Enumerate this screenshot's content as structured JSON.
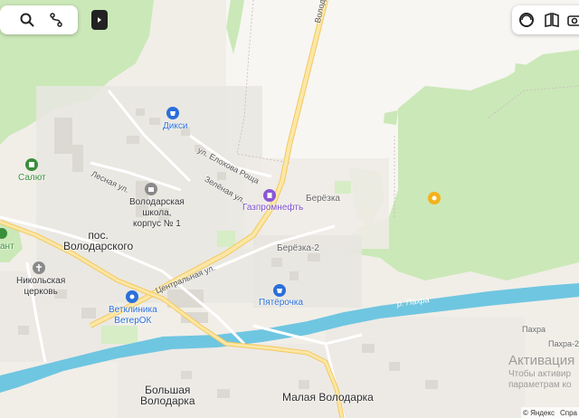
{
  "toolbar_left": {
    "search_icon": "search-icon",
    "route_icon": "route-icon",
    "collapse_icon": "play-arrow-icon"
  },
  "toolbar_right": {
    "icons": [
      "layers-icon",
      "map-book-icon",
      "camera-icon"
    ]
  },
  "settlements": {
    "volodarsky_line1": "пос.",
    "volodarsky_line2": "Володарского",
    "bolshaya_line1": "Большая",
    "bolshaya_line2": "Володарка",
    "malaya": "Малая Володарка",
    "berezka": "Берёзка",
    "berezka2": "Берёзка-2",
    "pakhra": "Пахра",
    "pakhra2": "Пахра-2"
  },
  "pois": {
    "diksi": "Дикси",
    "salyut": "Салют",
    "school_line1": "Володарская",
    "school_line2": "школа,",
    "school_line3": "корпус № 1",
    "gazprom": "Газпромнефть",
    "church_line1": "Никольская",
    "church_line2": "церковь",
    "vet_line1": "Ветклиника",
    "vet_line2": "ВетерОК",
    "pyaterochka": "Пятёрочка",
    "partial_left": "ант"
  },
  "streets": {
    "volodarka_road": "Володарка",
    "eliseeva": "ул. Елохова Роща",
    "lesnaya": "Лесная ул.",
    "zelenaya": "Зелёная ул.",
    "centralnaya": "Центральная ул."
  },
  "river": {
    "name": "р. Пахра"
  },
  "watermark": {
    "line1": "Активация",
    "line2": "Чтобы активир",
    "line3": "параметрам ко"
  },
  "footer": {
    "brand": "© Яндекс",
    "help": "Спра"
  },
  "colors": {
    "forest": "#cbe8b8",
    "river": "#6fc6e0",
    "road_major": "#f7d87a",
    "poi_blue": "#2a6fdb",
    "poi_green": "#3a8f3a"
  }
}
